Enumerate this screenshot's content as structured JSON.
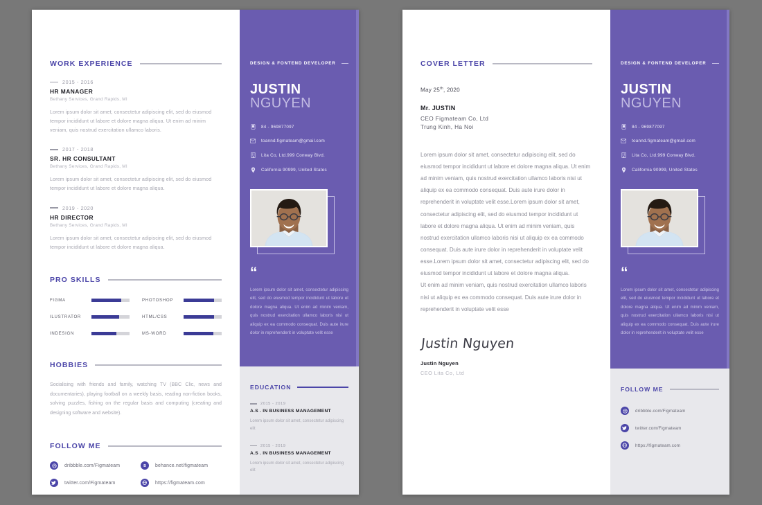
{
  "theme": {
    "purple": "#6a5cb0",
    "accent": "#4b45a8",
    "skill_bar": "#3b3b96",
    "grey_panel": "#e8e8ec",
    "canvas": "#787878"
  },
  "person": {
    "first_name": "JUSTIN",
    "last_name": "NGUYEN",
    "tagline": "DESIGN & FONTEND DEVELOPER",
    "phone": "84 - 969877097",
    "email": "toannd.figmateam@gmail.com",
    "company": "Lita Co, Ltd.999 Conway Blvd.",
    "address": "California 90999, United States"
  },
  "page_one": {
    "work": {
      "heading": "WORK EXPERIENCE",
      "entries": [
        {
          "date": "2015 - 2016",
          "role": "HR MANAGER",
          "org": "Bethany Services, Grand Rapids, MI",
          "desc": "Lorem ipsum dolor sit amet, consectetur adipiscing elit, sed do eiusmod tempor incididunt ut labore et dolore magna aliqua. Ut enim ad minim veniam, quis nostrud exercitation ullamco laboris."
        },
        {
          "date": "2017 - 2018",
          "role": "SR. HR CONSULTANT",
          "org": "Bethany Services, Grand Rapids, MI",
          "desc": "Lorem ipsum dolor sit amet, consectetur adipiscing elit, sed do eiusmod tempor incididunt ut labore et dolore magna aliqua."
        },
        {
          "date": "2019 - 2020",
          "role": "HR DIRECTOR",
          "org": "Bethany Services, Grand Rapids, MI",
          "desc": "Lorem ipsum dolor sit amet, consectetur adipiscing elit, sed do eiusmod tempor incididunt ut labore et dolore magna aliqua."
        }
      ]
    },
    "skills": {
      "heading": "PRO SKILLS",
      "items": [
        {
          "name": "FIGMA",
          "level": 78
        },
        {
          "name": "PHOTOSHOP",
          "level": 80
        },
        {
          "name": "ILUSTRATOR",
          "level": 72
        },
        {
          "name": "HTML/CSS",
          "level": 80
        },
        {
          "name": "INDESIGN",
          "level": 65
        },
        {
          "name": "MS-WORD",
          "level": 78
        }
      ]
    },
    "hobbies": {
      "heading": "HOBBIES",
      "text": "Socialising with friends and family, watching TV (BBC Clic, news and documentaries), playing football on a weekly basis, reading non-fiction books, solving puzzles, fishing on the regular basis and computing (creating and designing software and website)."
    },
    "follow": {
      "heading": "FOLLOW ME",
      "links": [
        {
          "icon": "dribbble-icon",
          "text": "dribbble.com/Figmateam"
        },
        {
          "icon": "behance-icon",
          "text": "behance.net/figmateam"
        },
        {
          "icon": "twitter-icon",
          "text": "twitter.com/Figmateam"
        },
        {
          "icon": "globe-icon",
          "text": "https://figmateam.com"
        }
      ]
    },
    "quote": "Lorem ipsum dolor sit amet, consectetur adipiscing elit, sed do eiusmod tempor incididunt ut labore et dolore magna aliqua. Ut enim ad minim veniam, quis nostrud exercitation ullamco laboris nisi ut aliquip ex ea commodo consequat. Duis aute irure dolor in reprehenderit in voluptate velit esse",
    "education": {
      "heading": "EDUCATION",
      "entries": [
        {
          "date": "2015 - 2019",
          "degree": "A.S . IN BUSINESS MANAGEMENT",
          "desc": "Lorem ipsum dolor sit amet, consectetur adipiscing elit"
        },
        {
          "date": "2015 - 2019",
          "degree": "A.S . IN BUSINESS MANAGEMENT",
          "desc": "Lorem ipsum dolor sit amet, consectetur adipiscing elit"
        }
      ]
    }
  },
  "page_two": {
    "heading": "COVER LETTER",
    "date": "May 25",
    "date_sup": "th",
    "date_year": ", 2020",
    "recipient": {
      "name": "Mr. JUSTIN",
      "line2": "CEO Figmateam  Co, Ltd",
      "line3": "Trung Kinh, Ha Noi"
    },
    "body": [
      "Lorem ipsum dolor sit amet, consectetur adipiscing elit, sed do eiusmod tempor incididunt ut labore et dolore magna aliqua. Ut enim ad minim veniam, quis nostrud exercitation ullamco laboris nisi ut aliquip ex ea commodo consequat. Duis aute irure dolor in reprehenderit in voluptate velit esse.Lorem ipsum dolor sit amet, consectetur adipiscing elit, sed do eiusmod tempor incididunt ut labore et dolore magna aliqua. Ut enim ad minim veniam, quis nostrud exercitation ullamco laboris nisi ut aliquip ex ea commodo consequat. Duis aute irure dolor in reprehenderit in voluptate velit esse.Lorem ipsum dolor sit amet, consectetur adipiscing elit, sed do eiusmod tempor incididunt ut labore et dolore magna aliqua.",
      "Ut enim ad minim veniam, quis nostrud exercitation ullamco laboris nisi ut aliquip ex ea commodo consequat. Duis aute irure dolor in reprehenderit in voluptate velit esse"
    ],
    "signature": "Justin Nguyen",
    "signer_name": "Justin Nguyen",
    "signer_role": "CEO Lita Co, Ltd",
    "quote": "Lorem ipsum dolor sit amet, consectetur adipiscing elit, sed do eiusmod tempor incididunt ut labore et dolore magna aliqua. Ut enim ad minim veniam, quis nostrud exercitation ullamco laboris nisi ut aliquip ex ea commodo consequat. Duis aute irure dolor in reprehenderit in voluptate velit esse",
    "follow": {
      "heading": "FOLLOW ME",
      "links": [
        {
          "icon": "dribbble-icon",
          "text": "dribbble.com/Figmateam"
        },
        {
          "icon": "twitter-icon",
          "text": "twitter.com/Figmateam"
        },
        {
          "icon": "globe-icon",
          "text": "https://figmateam.com"
        }
      ]
    }
  }
}
